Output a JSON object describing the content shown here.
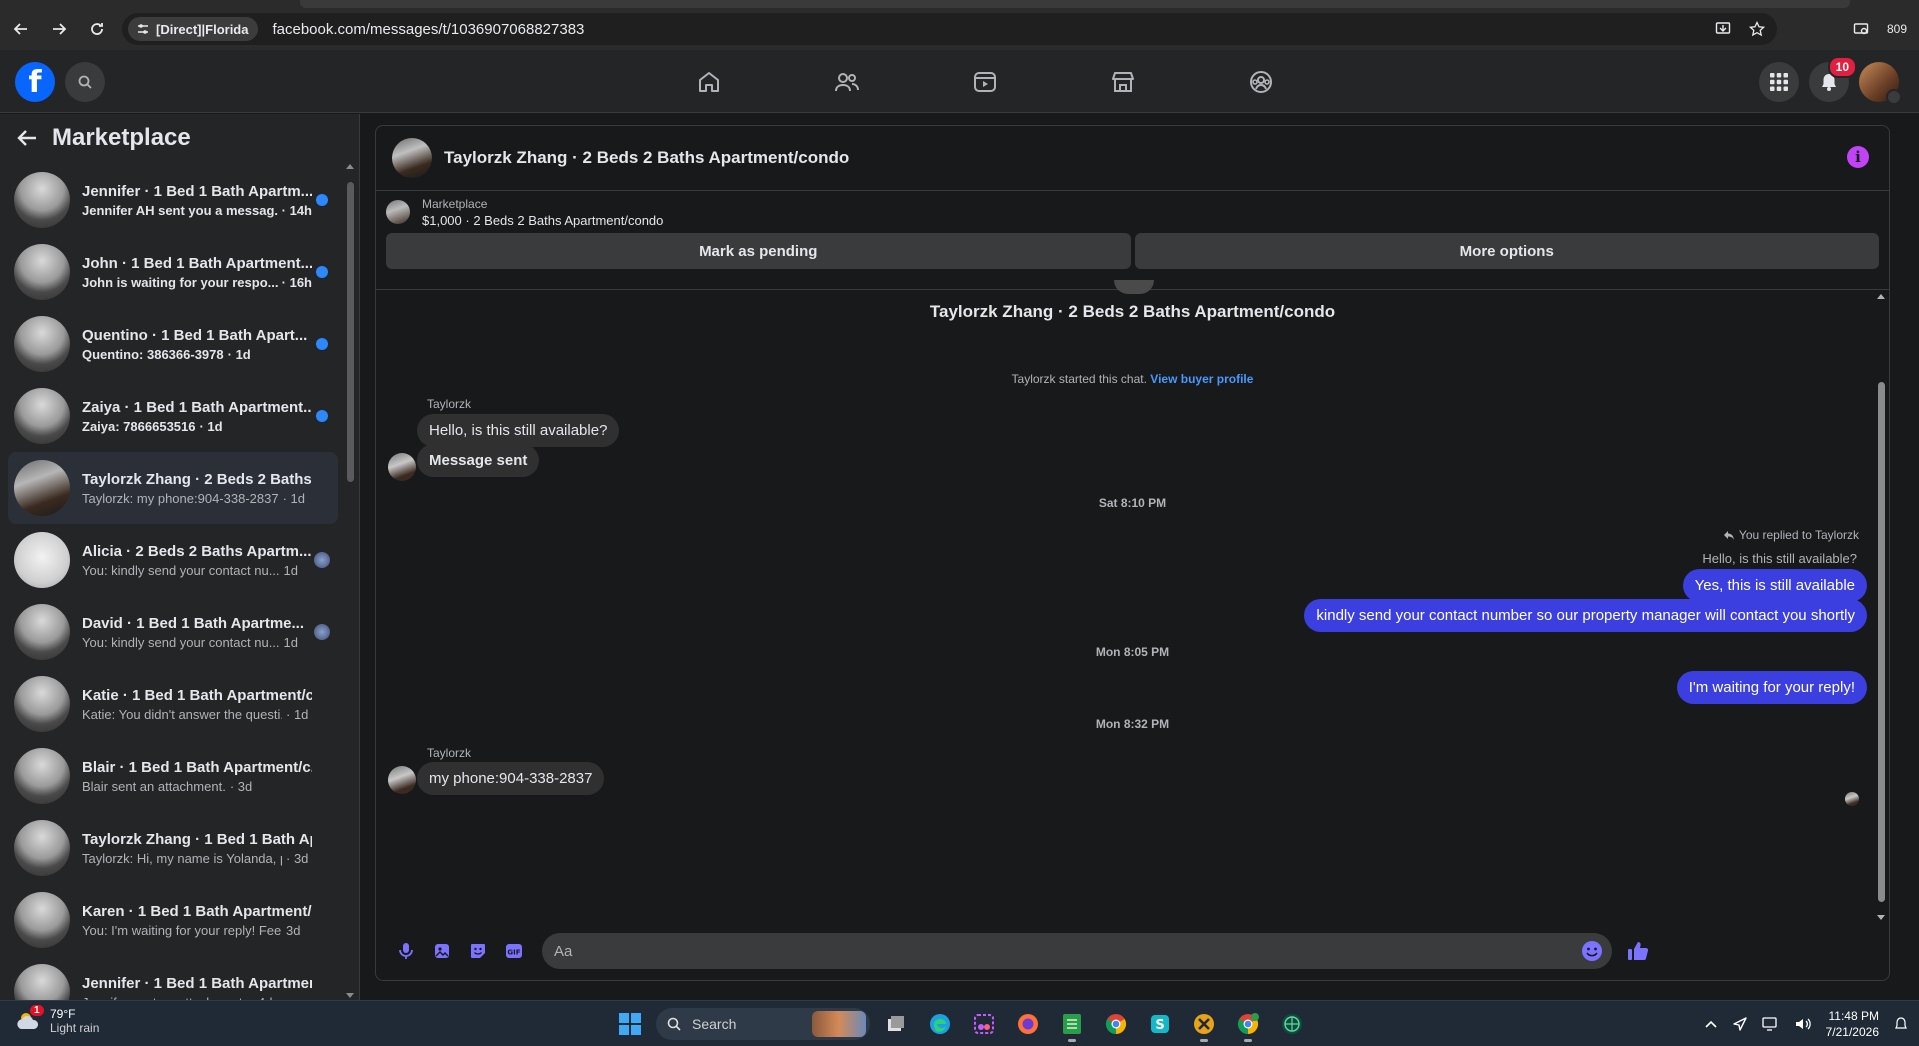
{
  "browser": {
    "site_chip": "[Direct]|Florida",
    "url": "facebook.com/messages/t/1036907068827383",
    "extension_count": "809"
  },
  "header": {
    "notification_count": "10",
    "nav_icons": [
      "home-icon",
      "friends-icon",
      "video-icon",
      "marketplace-icon",
      "groups-icon"
    ]
  },
  "sidebar": {
    "title": "Marketplace",
    "conversations": [
      {
        "name": "Jennifer · 1 Bed 1 Bath Apartm...",
        "snippet": "Jennifer AH sent you a messag...",
        "time": "· 14h",
        "unread": true
      },
      {
        "name": "John · 1 Bed 1 Bath Apartment...",
        "snippet": "John is waiting for your respo...",
        "time": "· 16h",
        "unread": true
      },
      {
        "name": "Quentino · 1 Bed 1 Bath Apart...",
        "snippet": "Quentino: 386366-3978",
        "time": "· 1d",
        "unread": true
      },
      {
        "name": "Zaiya · 1 Bed 1 Bath Apartment...",
        "snippet": "Zaiya: 7866653516",
        "time": "· 1d",
        "unread": true
      },
      {
        "name": "Taylorzk Zhang · 2 Beds 2 Baths ...",
        "snippet": "Taylorzk: my phone:904-338-2837",
        "time": "· 1d",
        "unread": false
      },
      {
        "name": "Alicia · 2 Beds 2 Baths Apartm...",
        "snippet": "You: kindly send your contact nu...",
        "time": "1d",
        "unread": false
      },
      {
        "name": "David · 1 Bed 1 Bath Apartme...",
        "snippet": "You: kindly send your contact nu...",
        "time": "1d",
        "unread": false
      },
      {
        "name": "Katie · 1 Bed 1 Bath Apartment/c...",
        "snippet": "Katie: You didn't answer the questi...",
        "time": "· 1d",
        "unread": false
      },
      {
        "name": "Blair · 1 Bed 1 Bath Apartment/c...",
        "snippet": "Blair sent an attachment.",
        "time": "· 3d",
        "unread": false
      },
      {
        "name": "Taylorzk Zhang · 1 Bed 1 Bath Ap...",
        "snippet": "Taylorzk: Hi, my name is Yolanda, p...",
        "time": "· 3d",
        "unread": false
      },
      {
        "name": "Karen · 1 Bed 1 Bath Apartment/...",
        "snippet": "You: I'm waiting for your reply! Feel...",
        "time": "3d",
        "unread": false
      },
      {
        "name": "Jennifer · 1 Bed 1 Bath Apartmen...",
        "snippet": "Jennifer sent an attachment.",
        "time": "· 4d",
        "unread": false
      }
    ]
  },
  "chat": {
    "title": "Taylorzk Zhang · 2 Beds 2 Baths Apartment/condo",
    "listing_label": "Marketplace",
    "listing_price": "$1,000 · 2 Beds 2 Baths Apartment/condo",
    "mark_pending": "Mark as pending",
    "more_options": "More options",
    "thread_title": "Taylorzk Zhang · 2 Beds 2 Baths Apartment/condo",
    "started_text": "Taylorzk started this chat.",
    "view_profile": "View buyer profile",
    "sender1": "Taylorzk",
    "msg1": "Hello, is this still available?",
    "msg2": "Message sent",
    "time1": "Sat 8:10 PM",
    "replied_label": "You replied to Taylorzk",
    "quoted": "Hello, is this still available?",
    "out1": "Yes, this is still available",
    "out2": "kindly send your contact number so our property manager will contact you shortly",
    "time2": "Mon 8:05 PM",
    "out3": "I'm waiting for your reply!",
    "time3": "Mon 8:32 PM",
    "sender2": "Taylorzk",
    "msg3": "my phone:904-338-2837",
    "composer_placeholder": "Aa"
  },
  "taskbar": {
    "weather_badge": "1",
    "temp": "79°F",
    "condition": "Light rain",
    "search_label": "Search",
    "time": "11:48 PM",
    "date": "7/21/2026"
  },
  "colors": {
    "fb_blue": "#0866ff",
    "outgoing_bubble": "#3b3fe0",
    "unread_dot": "#2d88ff",
    "info_purple": "#c143f5"
  }
}
